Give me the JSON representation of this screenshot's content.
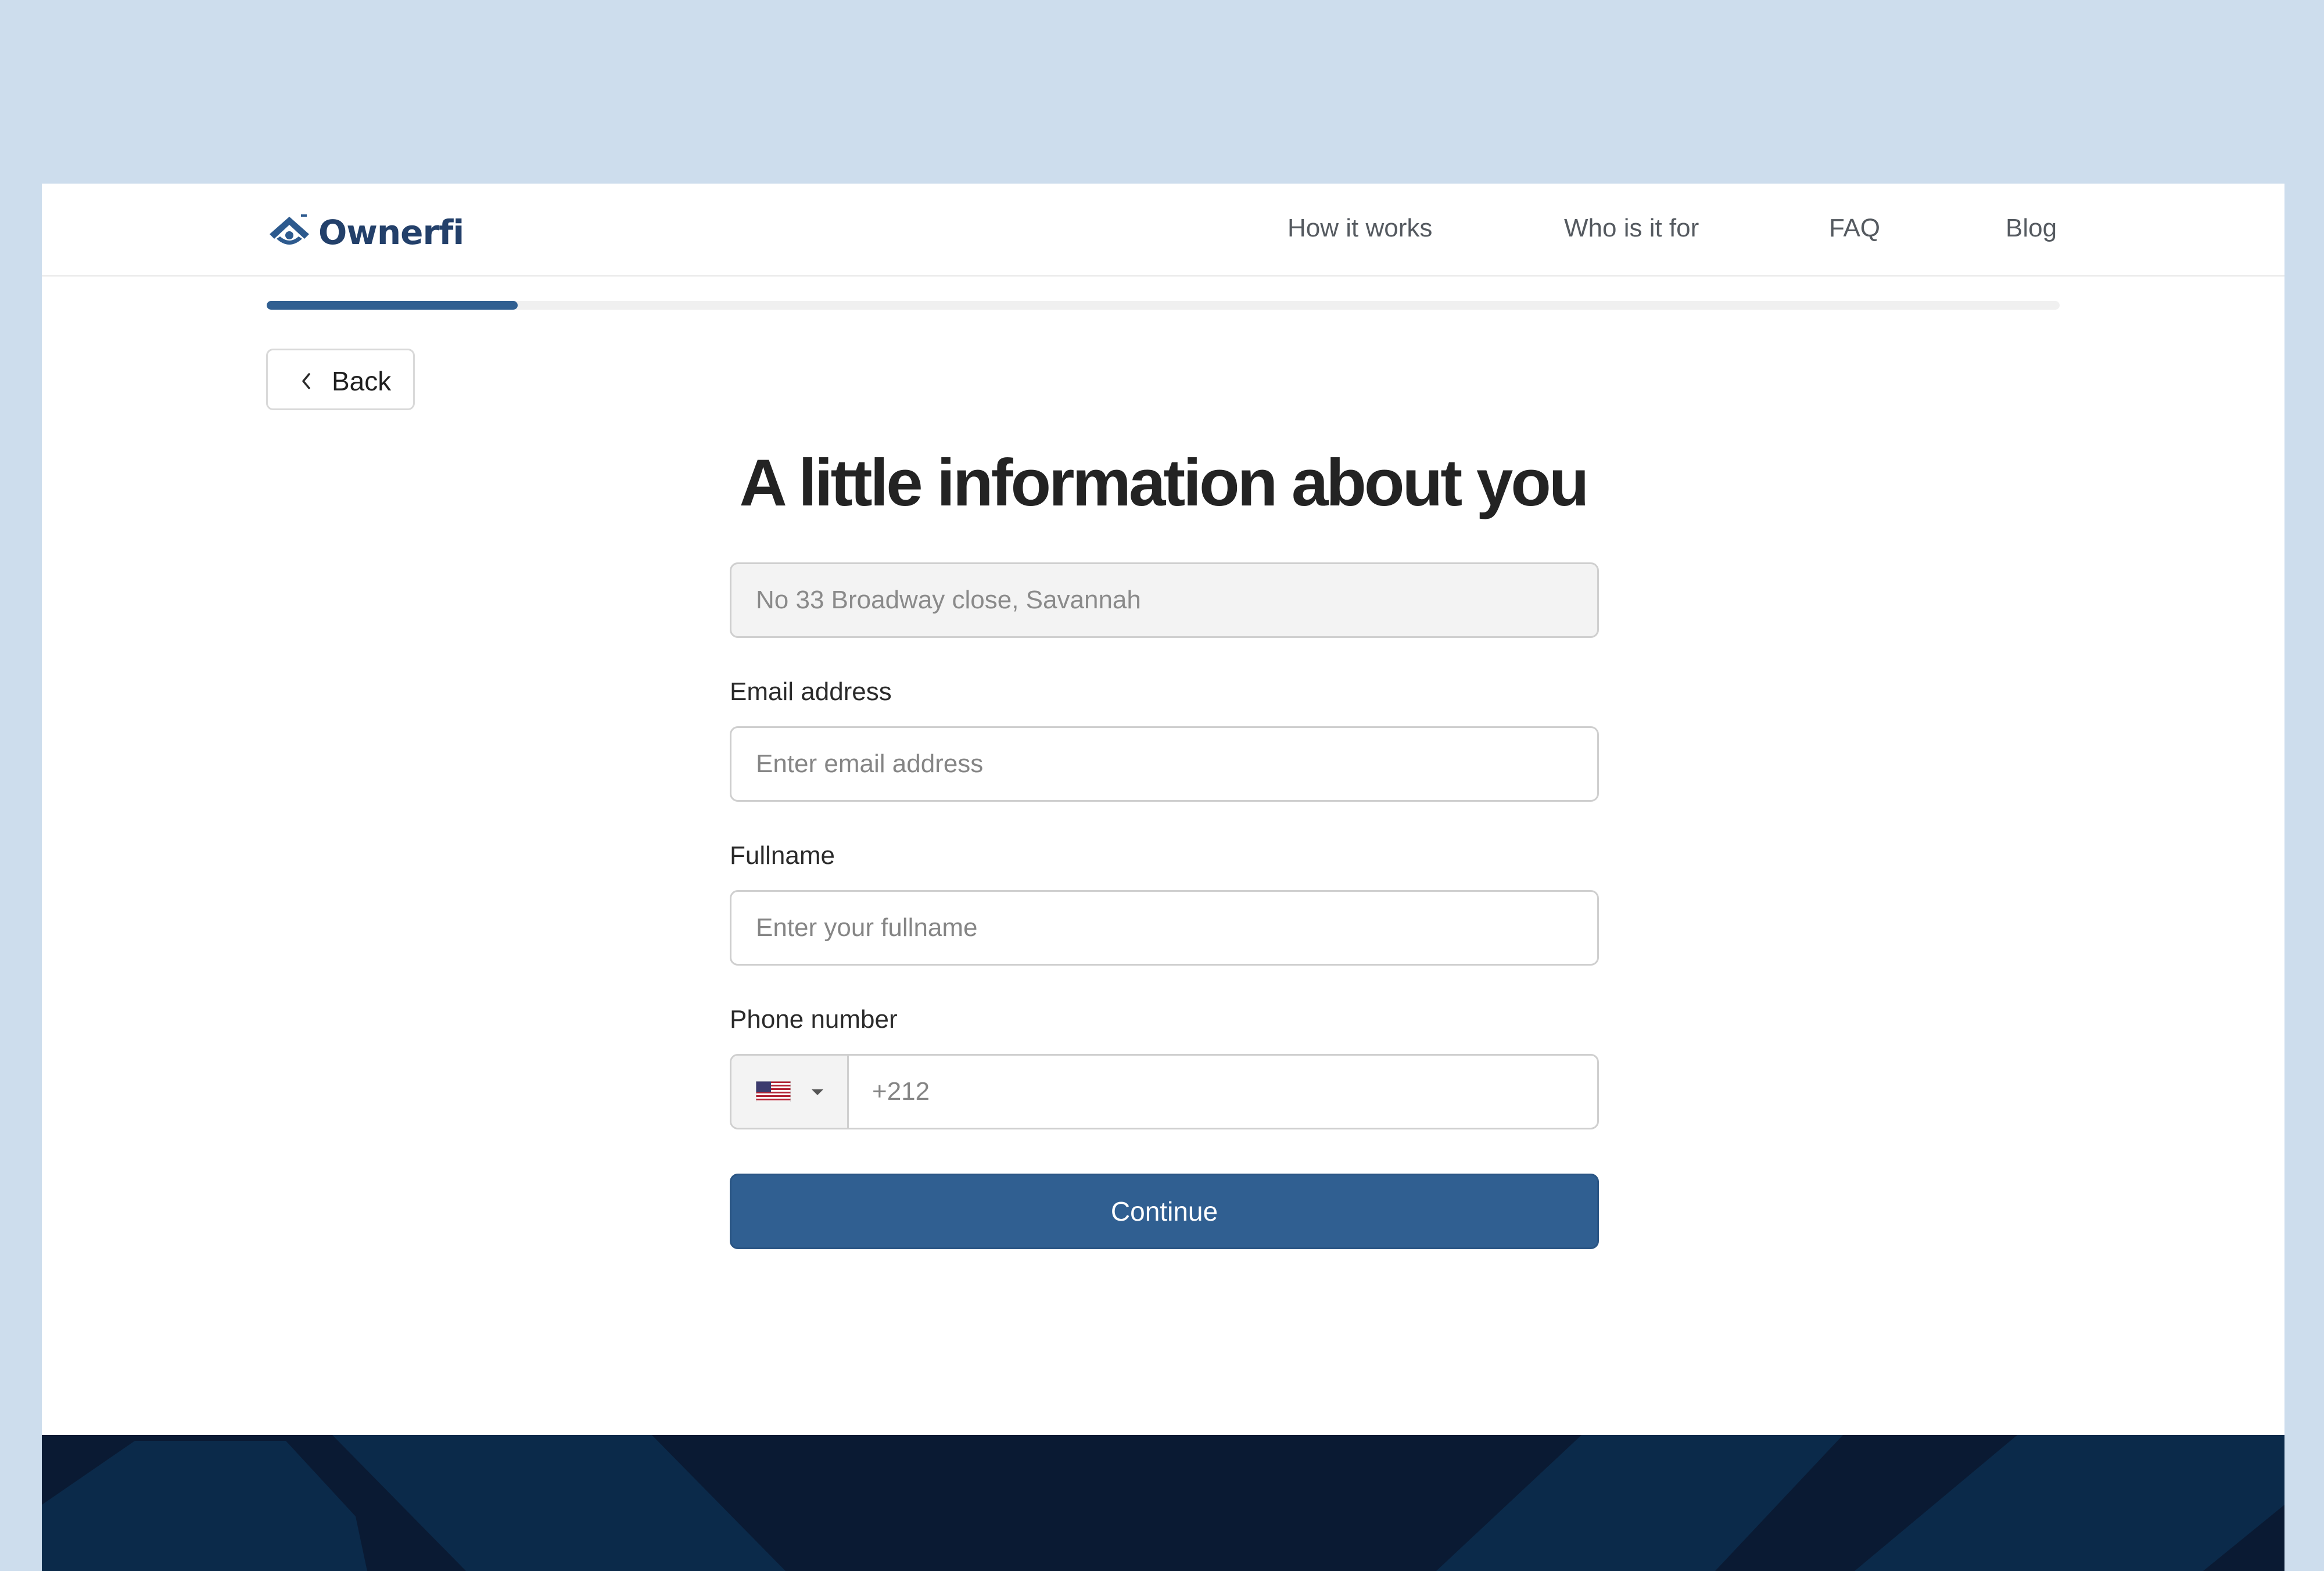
{
  "brand": {
    "name": "Ownerfi",
    "color": "#23406a"
  },
  "nav": {
    "items": [
      "How it works",
      "Who is it for",
      "FAQ",
      "Blog"
    ]
  },
  "progress": {
    "value": 0.14
  },
  "back": {
    "label": "Back",
    "icon": "chevron-left-icon"
  },
  "heading": "A little information about you",
  "form": {
    "address_value": "No 33 Broadway close, Savannah",
    "email": {
      "label": "Email address",
      "placeholder": "Enter email address"
    },
    "fullname": {
      "label": "Fullname",
      "placeholder": "Enter your fullname"
    },
    "phone": {
      "label": "Phone number",
      "placeholder": "+212",
      "country_icon": "us-flag-icon"
    },
    "submit_label": "Continue"
  },
  "colors": {
    "primary": "#305f91",
    "footer": "#0a1a33",
    "page_bg": "#cddded"
  }
}
